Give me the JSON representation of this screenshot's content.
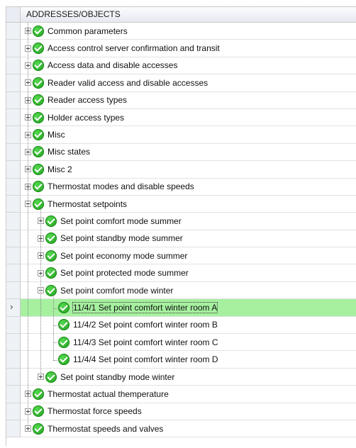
{
  "tree": {
    "column_header": "ADDRESSES/OBJECTS",
    "rows": [
      {
        "level": 0,
        "expander": "plus",
        "label": "Common parameters"
      },
      {
        "level": 0,
        "expander": "plus",
        "label": "Access control server confirmation and transit"
      },
      {
        "level": 0,
        "expander": "plus",
        "label": "Access data and disable accesses"
      },
      {
        "level": 0,
        "expander": "plus",
        "label": "Reader valid access and disable accesses"
      },
      {
        "level": 0,
        "expander": "plus",
        "label": "Reader access types"
      },
      {
        "level": 0,
        "expander": "plus",
        "label": "Holder access types"
      },
      {
        "level": 0,
        "expander": "plus",
        "label": "Misc"
      },
      {
        "level": 0,
        "expander": "plus",
        "label": "Misc states"
      },
      {
        "level": 0,
        "expander": "plus",
        "label": "Misc 2"
      },
      {
        "level": 0,
        "expander": "plus",
        "label": "Thermostat modes and disable speeds"
      },
      {
        "level": 0,
        "expander": "minus",
        "label": "Thermostat setpoints"
      },
      {
        "level": 1,
        "expander": "plus",
        "label": "Set point comfort mode summer"
      },
      {
        "level": 1,
        "expander": "plus",
        "label": "Set point standby mode summer"
      },
      {
        "level": 1,
        "expander": "plus",
        "label": "Set point economy mode summer"
      },
      {
        "level": 1,
        "expander": "plus",
        "label": "Set point protected mode summer"
      },
      {
        "level": 1,
        "expander": "minus",
        "label": "Set point comfort mode winter"
      },
      {
        "level": 2,
        "expander": "none",
        "label": "11/4/1 Set point comfort winter room A",
        "selected": true
      },
      {
        "level": 2,
        "expander": "none",
        "label": "11/4/2 Set point comfort winter room B"
      },
      {
        "level": 2,
        "expander": "none",
        "label": "11/4/3 Set point comfort winter room C"
      },
      {
        "level": 2,
        "expander": "none",
        "label": "11/4/4 Set point comfort winter room D"
      },
      {
        "level": 1,
        "expander": "plus",
        "label": "Set point standby mode winter"
      },
      {
        "level": 0,
        "expander": "plus",
        "label": "Thermostat actual themperature"
      },
      {
        "level": 0,
        "expander": "plus",
        "label": "Thermostat force speeds"
      },
      {
        "level": 0,
        "expander": "plus",
        "label": "Thermostat speeds and valves"
      }
    ],
    "current_row_indicator": "›",
    "colors": {
      "selected_row": "#a6f0a0",
      "status_ok": "#2fb52b"
    }
  }
}
